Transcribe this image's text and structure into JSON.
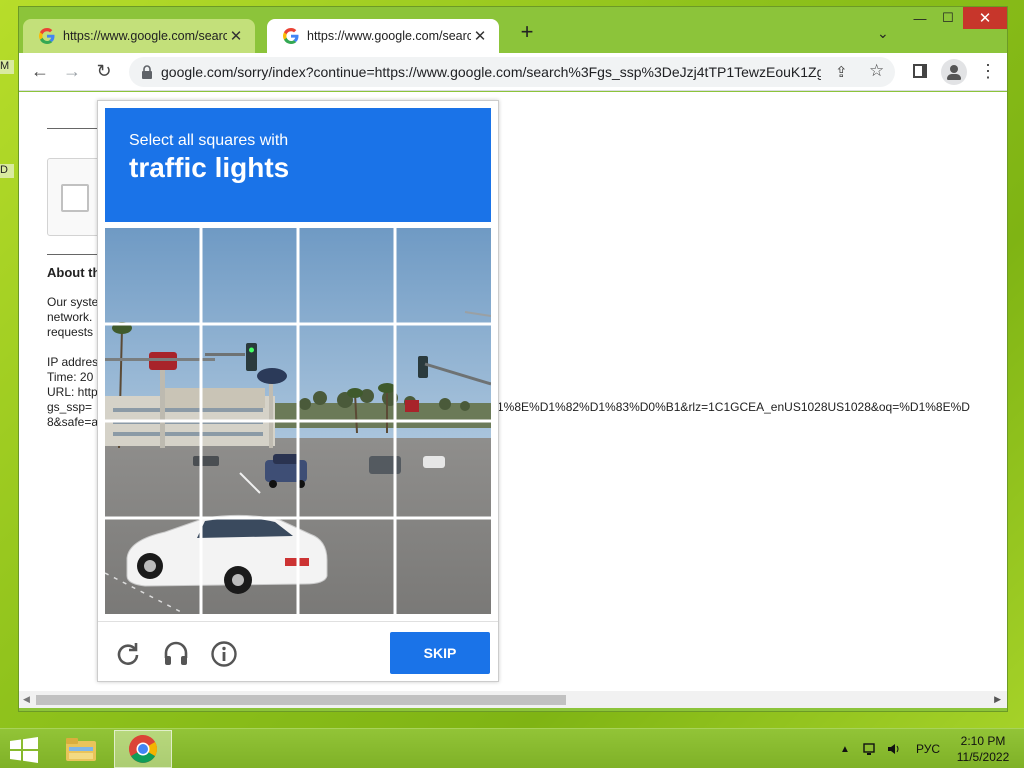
{
  "desktop": {
    "left_edge_labels": [
      "M",
      "D"
    ]
  },
  "tabs": [
    {
      "title": "https://www.google.com/search?q",
      "favicon": "google-g-icon",
      "active": false
    },
    {
      "title": "https://www.google.com/search?q",
      "favicon": "google-g-icon",
      "active": true
    }
  ],
  "tabbar": {
    "new_tab_label": "+",
    "tab_search_label": "⌄",
    "window_controls": {
      "minimize": "—",
      "maximize": "☐",
      "close": "✕"
    }
  },
  "toolbar": {
    "back": "←",
    "forward": "→",
    "reload": "↻",
    "url": "google.com/sorry/index?continue=https://www.google.com/search%3Fgs_ssp%3DeJzj4tTP1TewzEouK1Zg..."
  },
  "page": {
    "about_heading": "About th",
    "body_lines": [
      "Our syste",
      "network.",
      "requests"
    ],
    "ip_line": "IP addres",
    "time_line": "Time: 20",
    "url_line": "URL: http",
    "gs_line": "gs_ssp=",
    "safe_line": "8&safe=a",
    "long_url_tail": "1%8E%D1%82%D1%83%D0%B1&rlz=1C1GCEA_enUS1028US1028&oq=%D1%8E%D"
  },
  "captcha": {
    "instruction": "Select all squares with",
    "target": "traffic lights",
    "grid_size": 4,
    "skip_label": "SKIP",
    "footer_icons": [
      "reload-icon",
      "audio-challenge-icon",
      "info-icon"
    ]
  },
  "taskbar": {
    "apps": [
      "file-explorer-icon",
      "chrome-icon"
    ],
    "language": "РУС",
    "time": "2:10 PM",
    "date": "11/5/2022"
  }
}
